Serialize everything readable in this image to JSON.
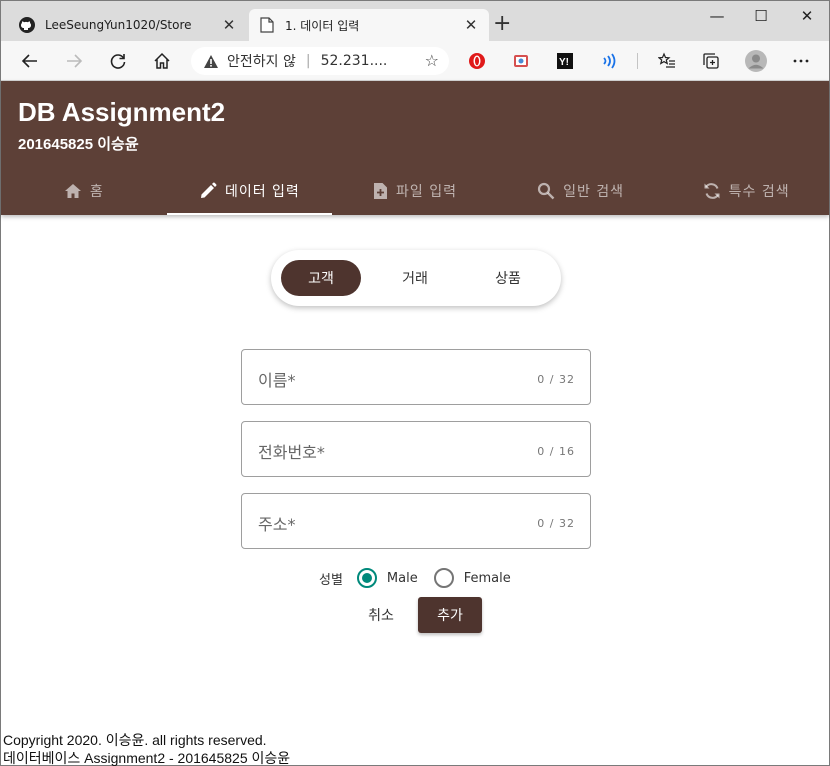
{
  "browser": {
    "tabs": [
      {
        "title": "LeeSeungYun1020/Store",
        "icon": "github-icon",
        "active": false
      },
      {
        "title": "1. 데이터 입력",
        "icon": "page-icon",
        "active": true
      }
    ],
    "close_glyph": "✕",
    "new_tab_glyph": "+",
    "address": {
      "security_text": "안전하지 않",
      "url": "52.231...."
    },
    "window_controls": {
      "minimize": "—",
      "maximize": "☐",
      "close": "✕"
    }
  },
  "app": {
    "title": "DB Assignment2",
    "subtitle": "201645825 이승윤",
    "nav": [
      {
        "label": "홈",
        "icon": "home-icon"
      },
      {
        "label": "데이터 입력",
        "icon": "pencil-icon",
        "active": true
      },
      {
        "label": "파일 입력",
        "icon": "file-add-icon"
      },
      {
        "label": "일반 검색",
        "icon": "search-icon"
      },
      {
        "label": "특수 검색",
        "icon": "refresh-icon"
      }
    ]
  },
  "segment": {
    "options": [
      "고객",
      "거래",
      "상품"
    ],
    "selected": "고객"
  },
  "form": {
    "fields": [
      {
        "label": "이름*",
        "counter": "0 / 32"
      },
      {
        "label": "전화번호*",
        "counter": "0 / 16"
      },
      {
        "label": "주소*",
        "counter": "0 / 32"
      }
    ],
    "gender": {
      "label": "성별",
      "options": [
        "Male",
        "Female"
      ],
      "selected": "Male"
    },
    "cancel_label": "취소",
    "submit_label": "추가"
  },
  "footer": {
    "line1": "Copyright 2020. 이승윤. all rights reserved.",
    "line2": "데이터베이스 Assignment2 - 201645825 이승윤"
  },
  "colors": {
    "header": "#5d4037",
    "accent": "#4e342e",
    "radio": "#00897b"
  }
}
